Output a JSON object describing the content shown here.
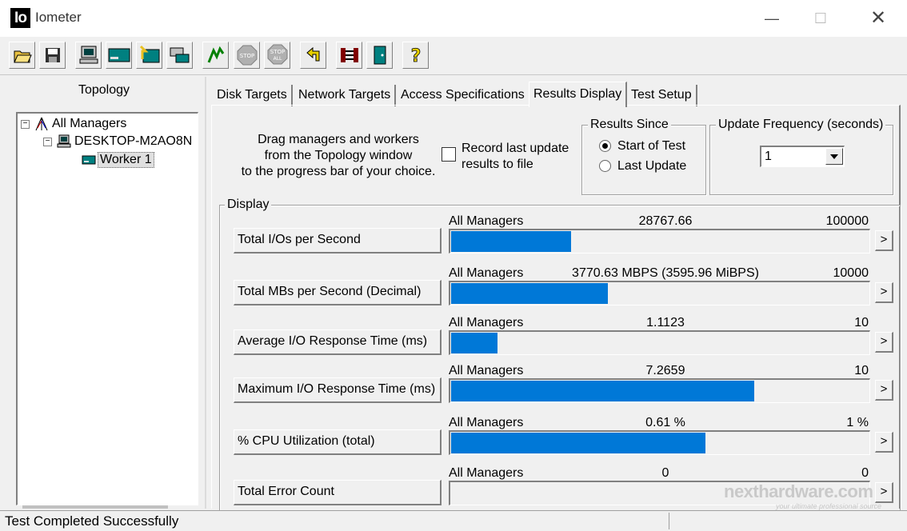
{
  "window": {
    "logo_text": "Io",
    "title": "Iometer",
    "minimize_glyph": "—",
    "maximize_glyph": "☐",
    "close_glyph": "✕"
  },
  "toolbar": {
    "buttons": [
      {
        "name": "open-config-button",
        "icon": "open-folder-icon"
      },
      {
        "name": "save-config-button",
        "icon": "floppy-disk-icon"
      },
      {
        "name": "start-new-manager-button",
        "icon": "computer-icon"
      },
      {
        "name": "start-disk-worker-button",
        "icon": "disk-worker-icon"
      },
      {
        "name": "start-network-worker-button",
        "icon": "network-worker-icon"
      },
      {
        "name": "duplicate-worker-button",
        "icon": "duplicate-worker-icon"
      },
      {
        "name": "start-tests-button",
        "icon": "green-flag-icon"
      },
      {
        "name": "stop-test-button",
        "icon": "stop-sign-icon",
        "text": "STOP"
      },
      {
        "name": "stop-all-button",
        "icon": "stop-all-icon",
        "text": "STOP",
        "subtext": "ALL"
      },
      {
        "name": "reset-workers-button",
        "icon": "undo-arrow-icon"
      },
      {
        "name": "disconnect-button",
        "icon": "disconnect-icon"
      },
      {
        "name": "exit-button",
        "icon": "exit-door-icon"
      },
      {
        "name": "help-button",
        "icon": "question-mark-icon",
        "text": "?"
      }
    ]
  },
  "topology": {
    "title": "Topology",
    "nodes": [
      {
        "label": "All Managers",
        "expander": "−",
        "icon": "all-managers-icon"
      },
      {
        "label": "DESKTOP-M2AO8N",
        "expander": "−",
        "icon": "computer-icon"
      },
      {
        "label": "Worker 1",
        "icon": "disk-worker-icon",
        "selected": true
      }
    ]
  },
  "tabs": [
    {
      "label": "Disk Targets"
    },
    {
      "label": "Network Targets"
    },
    {
      "label": "Access Specifications"
    },
    {
      "label": "Results Display",
      "active": true
    },
    {
      "label": "Test Setup"
    }
  ],
  "results": {
    "instructions": [
      "Drag managers and workers",
      "from the Topology window",
      "to the progress bar of your choice."
    ],
    "record_checkbox": {
      "checked": false,
      "label_lines": [
        "Record last update",
        "results to file"
      ]
    },
    "results_since": {
      "title": "Results Since",
      "options": [
        {
          "label": "Start of Test",
          "checked": true
        },
        {
          "label": "Last Update",
          "checked": false
        }
      ]
    },
    "update_frequency": {
      "title": "Update Frequency (seconds)",
      "value": "1"
    },
    "display": {
      "title": "Display",
      "more_glyph": ">",
      "rows": [
        {
          "metric": "Total I/Os per Second",
          "manager": "All Managers",
          "value": "28767.66",
          "max": "100000",
          "fraction": 0.2877
        },
        {
          "metric": "Total MBs per Second (Decimal)",
          "manager": "All Managers",
          "value": "3770.63 MBPS (3595.96 MiBPS)",
          "max": "10000",
          "fraction": 0.3771
        },
        {
          "metric": "Average I/O Response Time (ms)",
          "manager": "All Managers",
          "value": "1.1123",
          "max": "10",
          "fraction": 0.1112
        },
        {
          "metric": "Maximum I/O Response Time (ms)",
          "manager": "All Managers",
          "value": "7.2659",
          "max": "10",
          "fraction": 0.7266
        },
        {
          "metric": "% CPU Utilization (total)",
          "manager": "All Managers",
          "value": "0.61 %",
          "max": "1 %",
          "fraction": 0.61
        },
        {
          "metric": "Total Error Count",
          "manager": "All Managers",
          "value": "0",
          "max": "0",
          "fraction": 0
        }
      ]
    }
  },
  "status": {
    "text": "Test Completed Successfully"
  },
  "watermark": {
    "text": "nexthardware.com",
    "subtext": "your ultimate professional source"
  },
  "colors": {
    "bar_fill": "#0078d7",
    "background": "#f0f0f0"
  }
}
